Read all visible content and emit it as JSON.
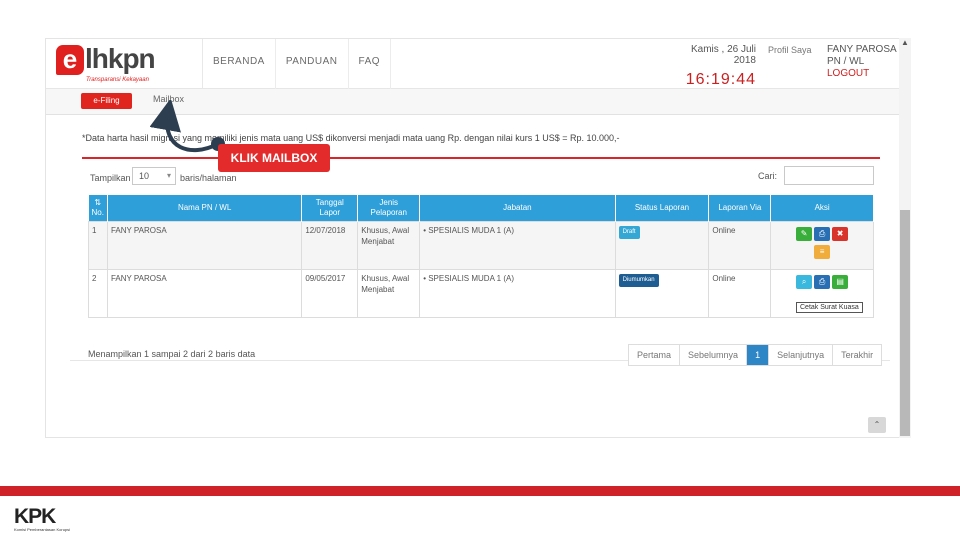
{
  "header": {
    "logo_text": "lhkpn",
    "logo_letter": "e",
    "logo_tagline": "Transparansi Kekayaan",
    "nav": [
      "BERANDA",
      "PANDUAN",
      "FAQ"
    ],
    "date": "Kamis , 26 Juli 2018",
    "time": "16:19:44",
    "profil_label": "Profil Saya",
    "user_name": "FANY PAROSA",
    "user_role": "PN / WL",
    "logout_label": "LOGOUT"
  },
  "subnav": {
    "efiling_label": "e-Filing",
    "mailbox_label": "Mailbox"
  },
  "content": {
    "note": "*Data harta hasil migrasi yang memiliki jenis mata uang US$ dikonversi menjadi mata uang Rp. dengan nilai kurs 1 US$ = Rp. 10.000,-",
    "show_label": "Tampilkan",
    "show_value": "10",
    "show_suffix": "baris/halaman",
    "search_label": "Cari:",
    "search_placeholder": "",
    "table": {
      "headers": [
        "No.",
        "Nama PN / WL",
        "Tanggal Lapor",
        "Jenis Pelaporan",
        "Jabatan",
        "Status Laporan",
        "Laporan Via",
        "Aksi"
      ],
      "rows": [
        {
          "no": "1",
          "nama": "FANY PAROSA",
          "tanggal": "12/07/2018",
          "jenis": "Khusus, Awal Menjabat",
          "jabatan": "• SPESIALIS MUDA 1 (A)",
          "status": "Draft",
          "via": "Online"
        },
        {
          "no": "2",
          "nama": "FANY PAROSA",
          "tanggal": "09/05/2017",
          "jenis": "Khusus, Awal Menjabat",
          "jabatan": "• SPESIALIS MUDA 1 (A)",
          "status": "Diumumkan",
          "via": "Online"
        }
      ]
    },
    "info": "Menampilkan 1 sampai 2 dari 2 baris data",
    "pager": [
      "Pertama",
      "Sebelumnya",
      "1",
      "Selanjutnya",
      "Terakhir"
    ],
    "pager_active": "1",
    "tooltip": "Cetak Surat Kuasa"
  },
  "annotation": {
    "label": "KLIK MAILBOX",
    "color": "#e32b2b"
  },
  "footer": {
    "kpk_logo": "KPK",
    "kpk_subtitle": "Komisi Pemberantasan Korupsi"
  },
  "icons": {
    "edit": "pencil-icon",
    "print": "print-icon",
    "delete": "trash-icon",
    "list": "list-icon",
    "view": "search-icon",
    "doc": "document-icon"
  }
}
